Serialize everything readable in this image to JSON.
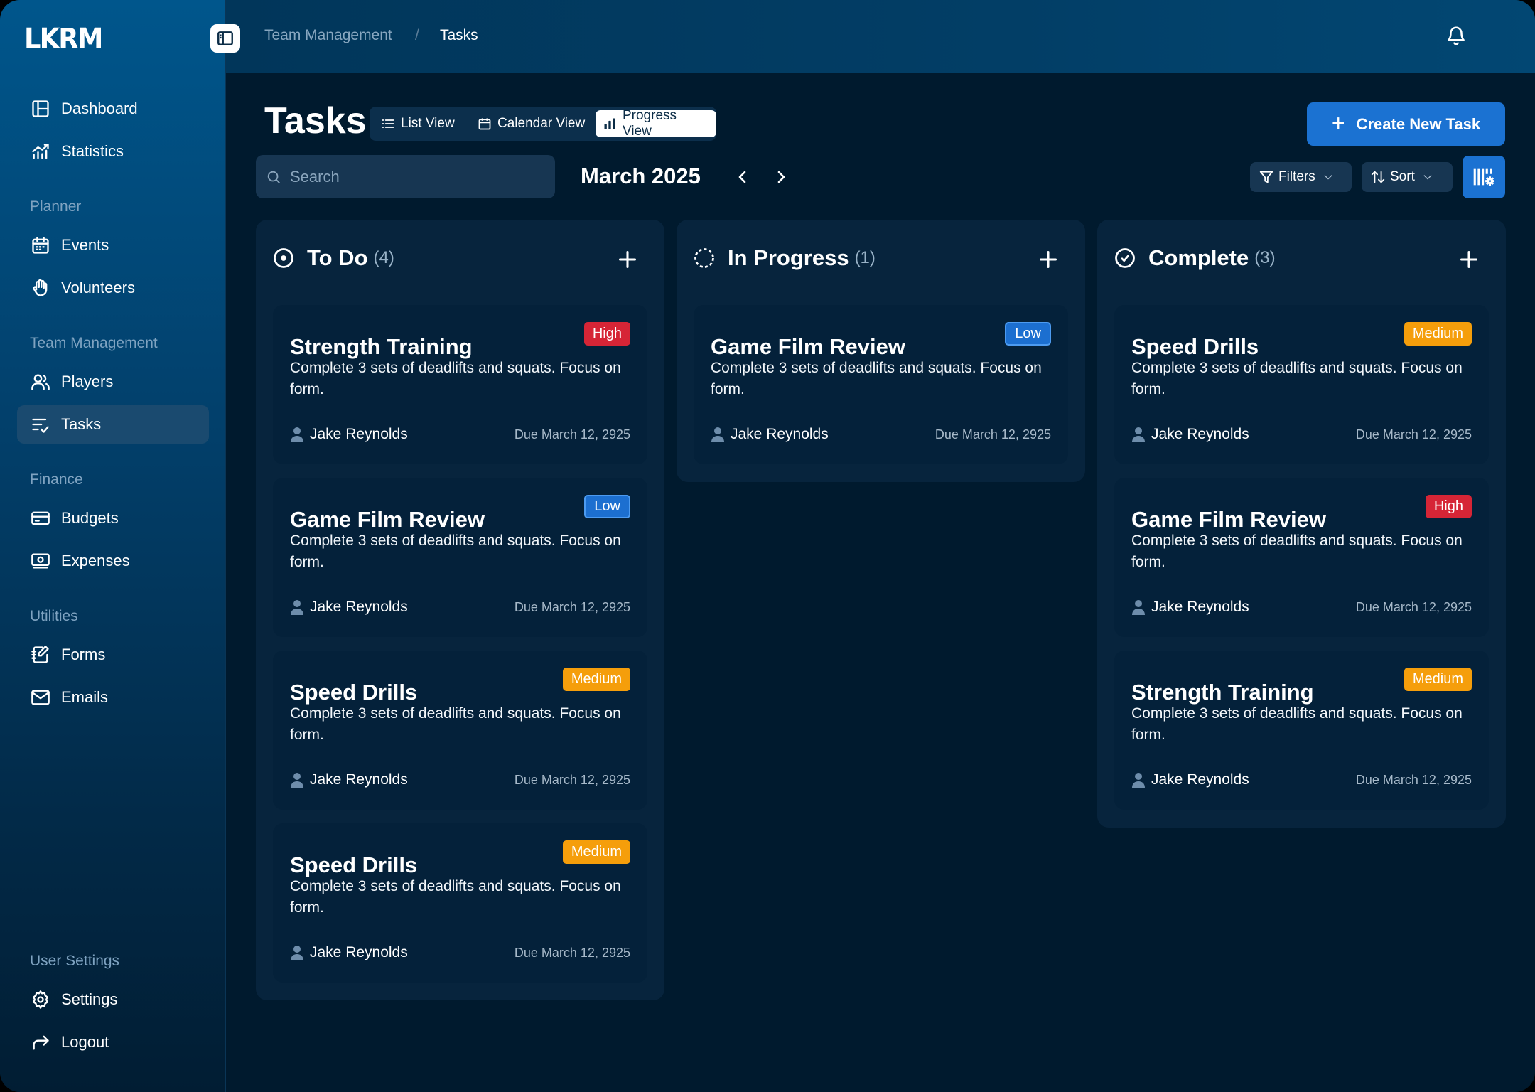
{
  "app": {
    "logo": "LKRM"
  },
  "sidebar": {
    "items_top": [
      {
        "label": "Dashboard",
        "icon": "dashboard-icon"
      },
      {
        "label": "Statistics",
        "icon": "statistics-icon"
      }
    ],
    "sections": [
      {
        "title": "Planner",
        "items": [
          {
            "label": "Events",
            "icon": "calendar-icon"
          },
          {
            "label": "Volunteers",
            "icon": "hand-icon"
          }
        ]
      },
      {
        "title": "Team Management",
        "items": [
          {
            "label": "Players",
            "icon": "users-icon"
          },
          {
            "label": "Tasks",
            "icon": "tasks-icon",
            "active": true
          }
        ]
      },
      {
        "title": "Finance",
        "items": [
          {
            "label": "Budgets",
            "icon": "card-icon"
          },
          {
            "label": "Expenses",
            "icon": "cash-icon"
          }
        ]
      },
      {
        "title": "Utilities",
        "items": [
          {
            "label": "Forms",
            "icon": "form-icon"
          },
          {
            "label": "Emails",
            "icon": "mail-icon"
          }
        ]
      }
    ],
    "user_settings": {
      "title": "User Settings",
      "settings": "Settings",
      "logout": "Logout"
    }
  },
  "header": {
    "breadcrumb": [
      "Team Management",
      "Tasks"
    ],
    "separator": "/"
  },
  "page": {
    "title": "Tasks",
    "views": [
      "List View",
      "Calendar View",
      "Progress View"
    ],
    "active_view": "Progress View",
    "create_button": "Create New Task",
    "search_placeholder": "Search",
    "month": "March 2025",
    "filters": "Filters",
    "sort": "Sort"
  },
  "columns": [
    {
      "title": "To Do",
      "count": "(4)",
      "status_icon": "todo-circle-icon",
      "cards": [
        {
          "title": "Strength Training",
          "priority": "High",
          "desc": "Complete 3 sets of deadlifts and squats. Focus on form.",
          "user": "Jake Reynolds",
          "due": "Due March 12, 2925"
        },
        {
          "title": "Game Film Review",
          "priority": "Low",
          "desc": "Complete 3 sets of deadlifts and squats. Focus on form.",
          "user": "Jake Reynolds",
          "due": "Due March 12, 2925"
        },
        {
          "title": "Speed Drills",
          "priority": "Medium",
          "desc": "Complete 3 sets of deadlifts and squats. Focus on form.",
          "user": "Jake Reynolds",
          "due": "Due March 12, 2925"
        },
        {
          "title": "Speed Drills",
          "priority": "Medium",
          "desc": "Complete 3 sets of deadlifts and squats. Focus on form.",
          "user": "Jake Reynolds",
          "due": "Due March 12, 2925"
        }
      ]
    },
    {
      "title": "In Progress",
      "count": "(1)",
      "status_icon": "progress-dashed-circle-icon",
      "cards": [
        {
          "title": "Game Film Review",
          "priority": "Low",
          "desc": "Complete 3 sets of deadlifts and squats. Focus on form.",
          "user": "Jake Reynolds",
          "due": "Due March 12, 2925"
        }
      ]
    },
    {
      "title": "Complete",
      "count": "(3)",
      "status_icon": "check-circle-icon",
      "cards": [
        {
          "title": "Speed Drills",
          "priority": "Medium",
          "desc": "Complete 3 sets of deadlifts and squats. Focus on form.",
          "user": "Jake Reynolds",
          "due": "Due March 12, 2925"
        },
        {
          "title": "Game Film Review",
          "priority": "High",
          "desc": "Complete 3 sets of deadlifts and squats. Focus on form.",
          "user": "Jake Reynolds",
          "due": "Due March 12, 2925"
        },
        {
          "title": "Strength Training",
          "priority": "Medium",
          "desc": "Complete 3 sets of deadlifts and squats. Focus on form.",
          "user": "Jake Reynolds",
          "due": "Due March 12, 2925"
        }
      ]
    }
  ],
  "colors": {
    "accent": "#1b72d2",
    "high": "#d62536",
    "low": "#1c6fd0",
    "medium": "#f59e0b",
    "background": "#001a2e"
  }
}
